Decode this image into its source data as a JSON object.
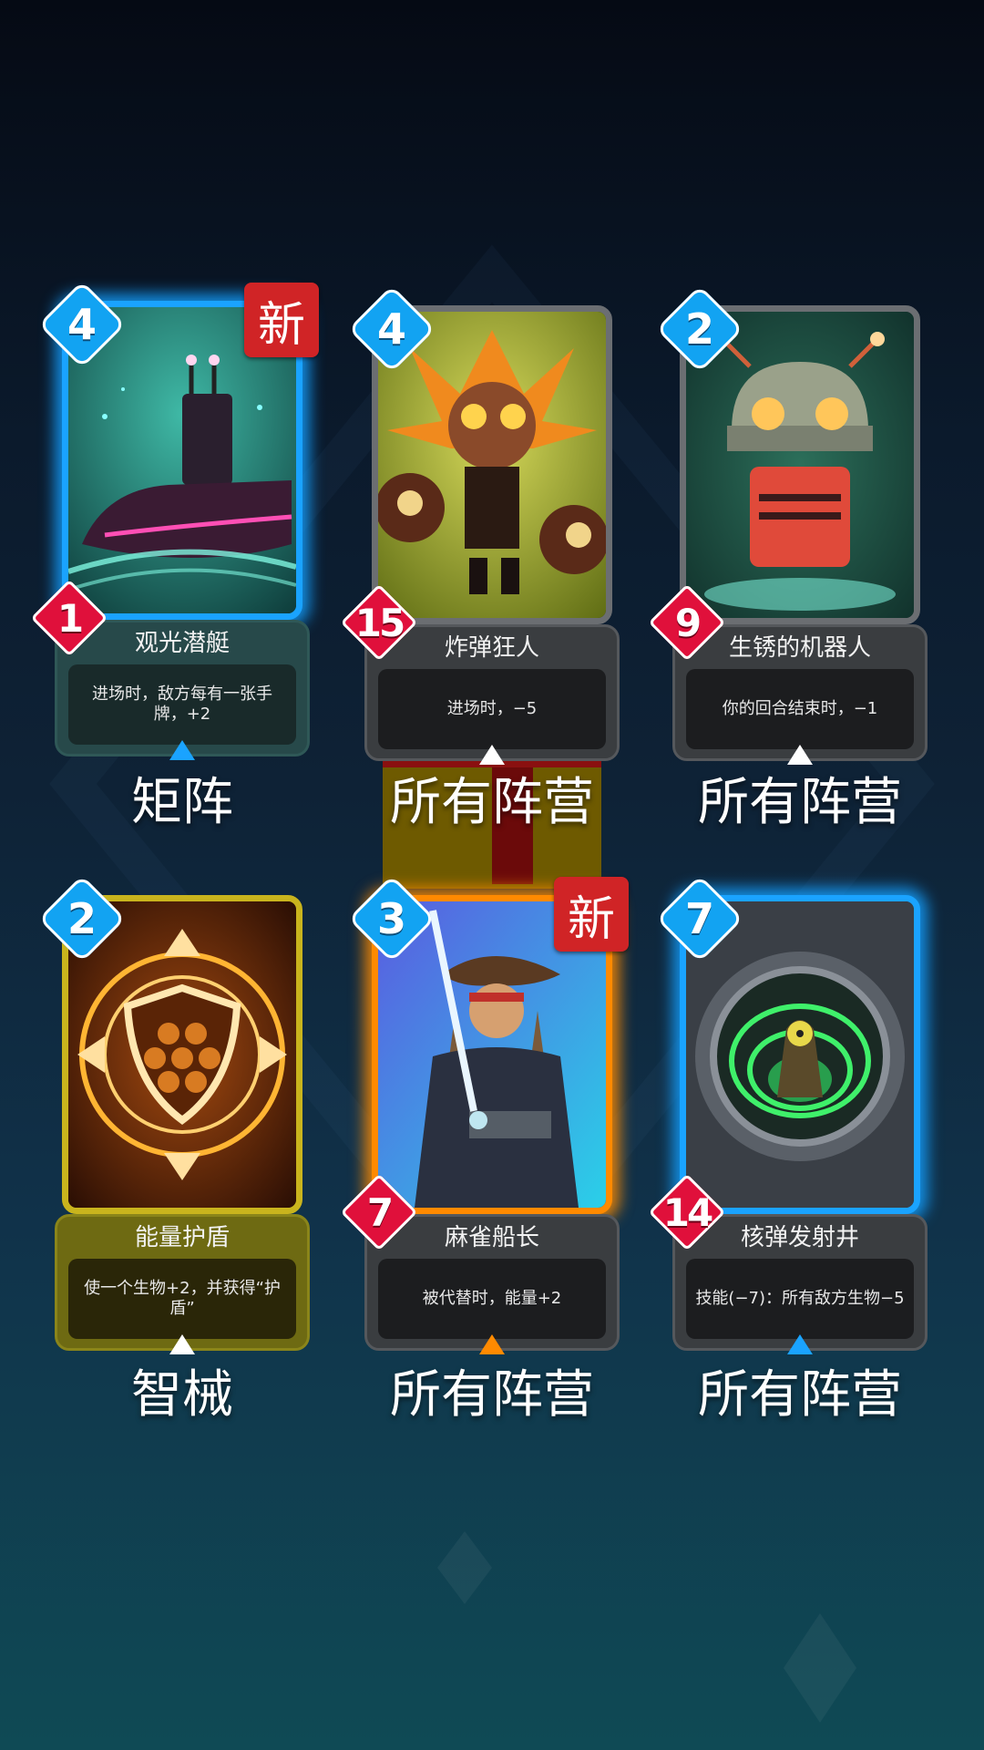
{
  "colors": {
    "cost_badge": "#12a3f2",
    "power_badge": "#e0103b",
    "new_tag": "#d02426",
    "glow_blue": "#1aa3ff",
    "glow_orange": "#ff8a00"
  },
  "new_tag_label": "新",
  "cards": [
    {
      "name": "观光潜艇",
      "description": "进场时，敌方每有一张手牌，+2",
      "cost": "4",
      "power": "1",
      "faction": "矩阵",
      "is_new": true,
      "rarity_glow": "blue",
      "art_icon": "submarine-icon"
    },
    {
      "name": "炸弹狂人",
      "description": "进场时，−5",
      "cost": "4",
      "power": "15",
      "faction": "所有阵营",
      "is_new": false,
      "rarity_glow": "none",
      "art_icon": "bomber-icon"
    },
    {
      "name": "生锈的机器人",
      "description": "你的回合结束时，−1",
      "cost": "2",
      "power": "9",
      "faction": "所有阵营",
      "is_new": false,
      "rarity_glow": "none",
      "art_icon": "robot-icon"
    },
    {
      "name": "能量护盾",
      "description": "使一个生物+2，并获得“护盾”",
      "cost": "2",
      "power": "",
      "faction": "智械",
      "is_new": false,
      "rarity_glow": "none",
      "art_icon": "shield-icon"
    },
    {
      "name": "麻雀船长",
      "description": "被代替时，能量+2",
      "cost": "3",
      "power": "7",
      "faction": "所有阵营",
      "is_new": true,
      "rarity_glow": "orange",
      "art_icon": "pirate-captain-icon"
    },
    {
      "name": "核弹发射井",
      "description": "技能(−7)：所有敌方生物−5",
      "cost": "7",
      "power": "14",
      "faction": "所有阵营",
      "is_new": false,
      "rarity_glow": "blue",
      "art_icon": "nuclear-silo-icon"
    }
  ]
}
